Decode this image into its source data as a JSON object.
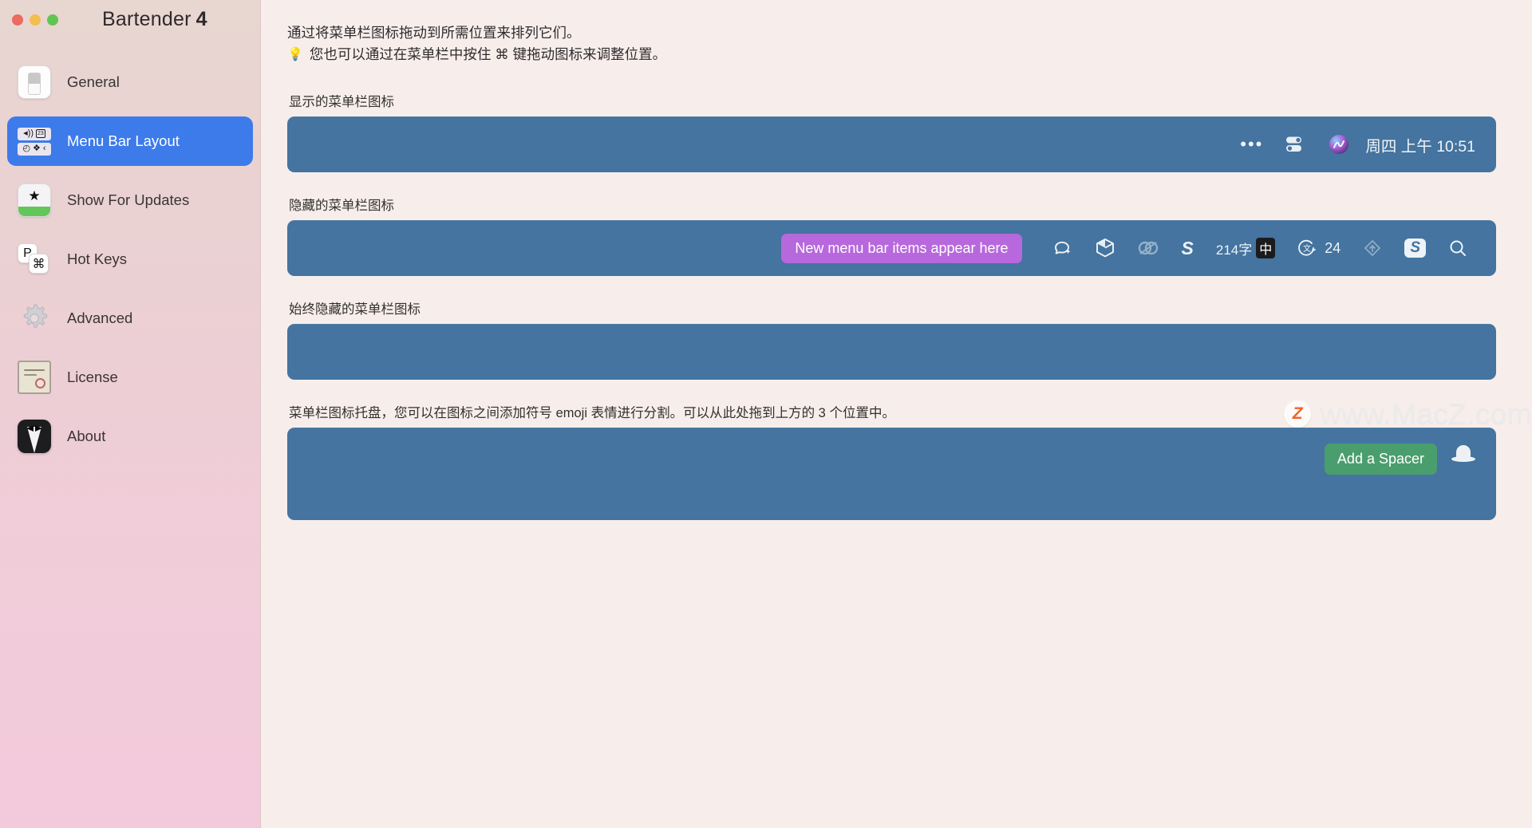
{
  "window": {
    "app_title": "Bartender",
    "app_version": "4",
    "traffic_lights": [
      "close",
      "minimize",
      "zoom"
    ]
  },
  "sidebar": {
    "items": [
      {
        "label": "General",
        "icon": "switch-icon",
        "selected": false
      },
      {
        "label": "Menu Bar Layout",
        "icon": "menubar-icon",
        "selected": true
      },
      {
        "label": "Show For Updates",
        "icon": "star-badge-icon",
        "selected": false
      },
      {
        "label": "Hot Keys",
        "icon": "keyboard-key-icon",
        "selected": false
      },
      {
        "label": "Advanced",
        "icon": "gear-icon",
        "selected": false
      },
      {
        "label": "License",
        "icon": "certificate-icon",
        "selected": false
      },
      {
        "label": "About",
        "icon": "tuxedo-icon",
        "selected": false
      }
    ],
    "menubar_icon_glyphs": {
      "row1_left": "◂))",
      "row1_right": "23",
      "row2": "◴ ❖ ‹"
    }
  },
  "main": {
    "intro_line1": "通过将菜单栏图标拖动到所需位置来排列它们。",
    "intro_bulb": "💡",
    "intro_line2": "您也可以通过在菜单栏中按住 ⌘ 键拖动图标来调整位置。",
    "sections": [
      {
        "label": "显示的菜单栏图标"
      },
      {
        "label": "隐藏的菜单栏图标"
      },
      {
        "label": "始终隐藏的菜单栏图标"
      },
      {
        "label": "菜单栏图标托盘，您可以在图标之间添加符号 emoji 表情进行分割。可以从此处拖到上方的 3 个位置中。"
      }
    ],
    "shown_bar": {
      "items": [
        {
          "name": "control-center-more-icon",
          "glyph": "•••"
        },
        {
          "name": "control-center-icon",
          "glyph": "toggle"
        },
        {
          "name": "siri-icon",
          "glyph": "siri"
        }
      ],
      "clock": "周四 上午 10:51"
    },
    "hidden_bar": {
      "badge": "New menu bar items appear here",
      "items": [
        {
          "name": "chat-sparkle-icon",
          "glyph": "chat"
        },
        {
          "name": "cube-icon",
          "glyph": "cube"
        },
        {
          "name": "creative-cloud-icon",
          "glyph": "cc"
        },
        {
          "name": "snipaste-s-icon",
          "glyph": "S"
        },
        {
          "name": "word-count-icon",
          "glyph": "214字"
        },
        {
          "name": "input-method-icon",
          "glyph": "中"
        },
        {
          "name": "translate-icon",
          "glyph": "文"
        },
        {
          "name": "battery-count-icon",
          "glyph": "24"
        },
        {
          "name": "upload-arrow-icon",
          "glyph": "⇧"
        },
        {
          "name": "snip-app-icon",
          "glyph": "S"
        },
        {
          "name": "spotlight-search-icon",
          "glyph": "search"
        }
      ]
    },
    "always_hidden_bar": {
      "items": []
    },
    "tray_bar": {
      "add_spacer_label": "Add a Spacer",
      "items": [
        {
          "name": "bowler-hat-icon",
          "glyph": "hat"
        }
      ]
    }
  },
  "watermark": {
    "logo_letter": "Z",
    "text": "www.MacZ.com"
  },
  "colors": {
    "accent_selected": "#3d7bea",
    "bar_blue": "#44749f",
    "badge_purple": "#b768dd",
    "spacer_green": "#4a9e6d",
    "content_bg": "#f7eeec"
  }
}
